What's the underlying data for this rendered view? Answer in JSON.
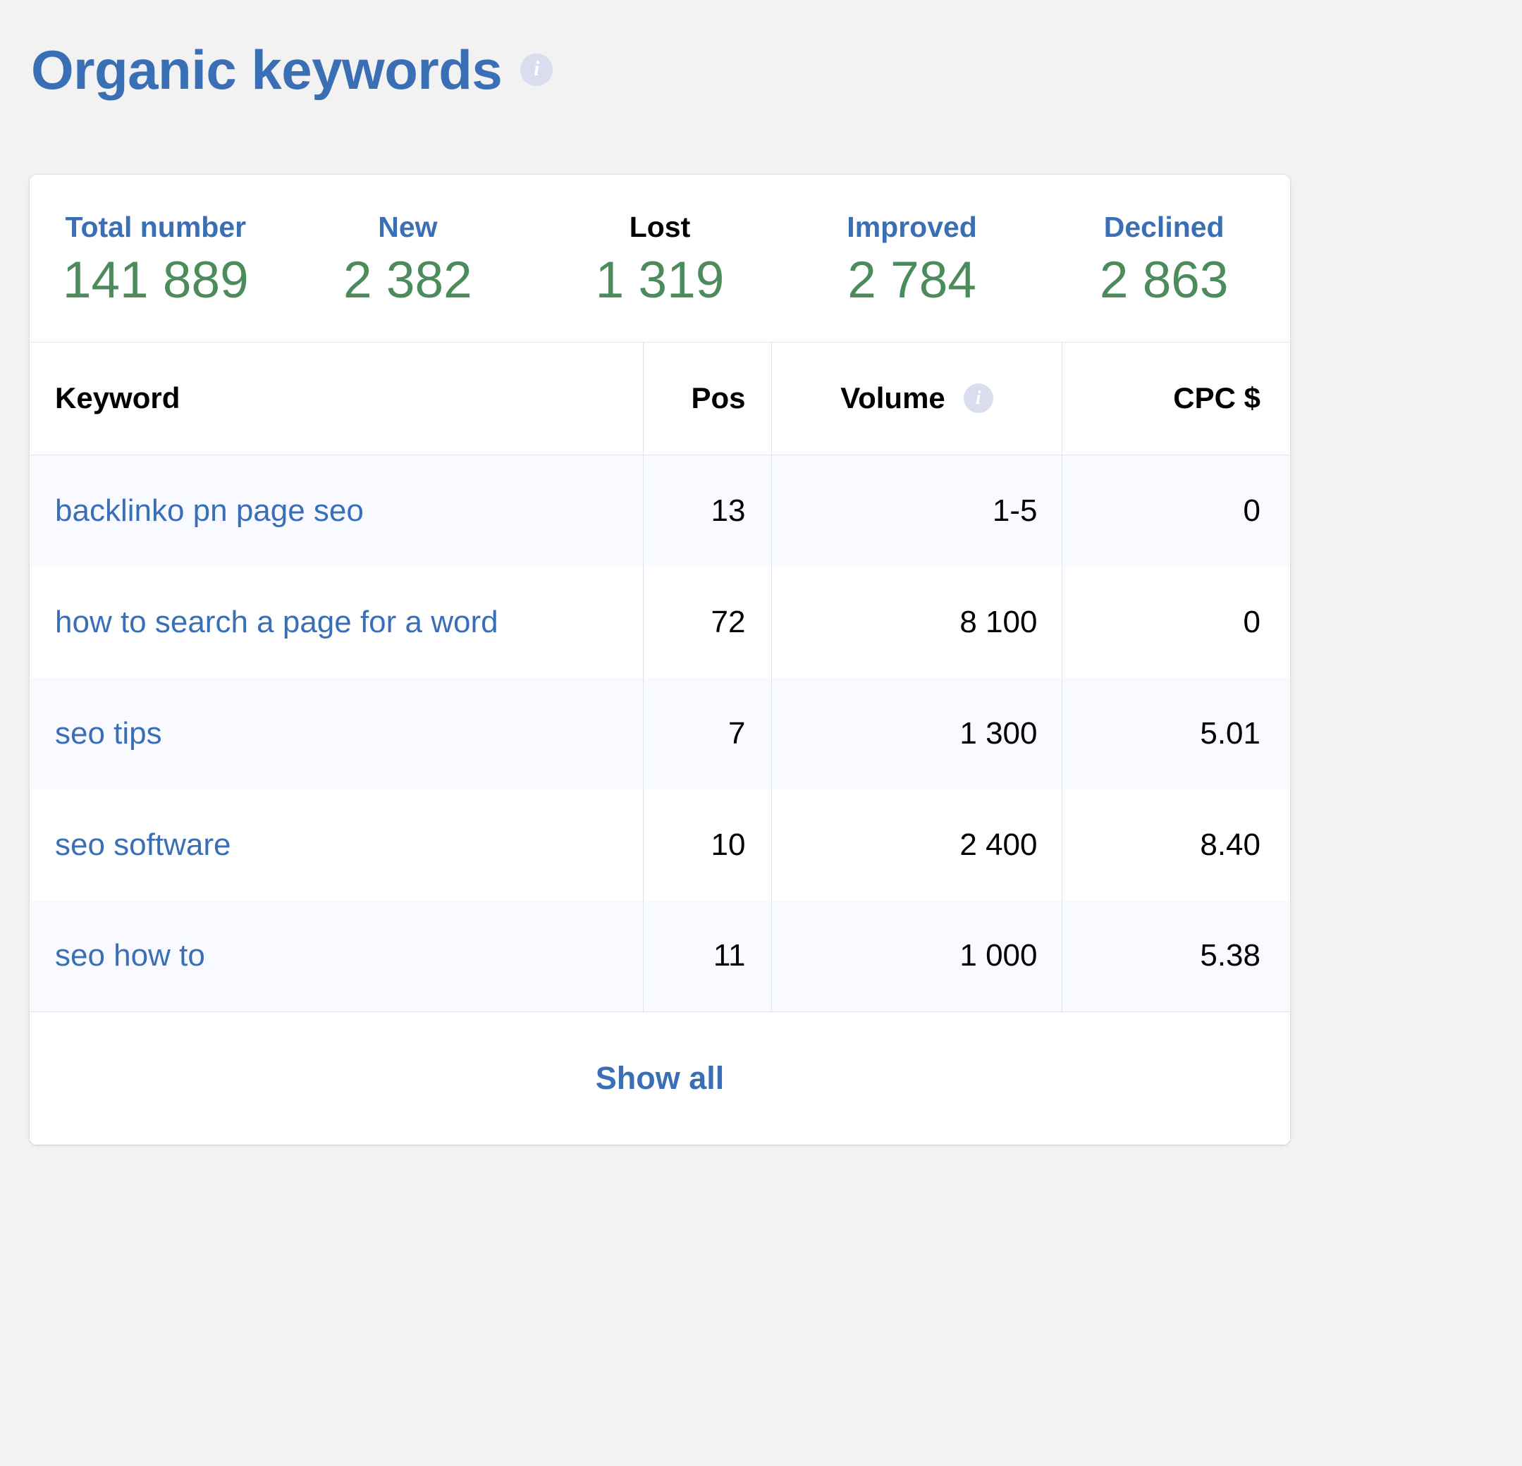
{
  "header": {
    "title": "Organic keywords",
    "info_icon": "info-icon"
  },
  "summary": {
    "items": [
      {
        "label": "Total number",
        "value": "141 889",
        "active": false
      },
      {
        "label": "New",
        "value": "2 382",
        "active": false
      },
      {
        "label": "Lost",
        "value": "1 319",
        "active": true
      },
      {
        "label": "Improved",
        "value": "2 784",
        "active": false
      },
      {
        "label": "Declined",
        "value": "2 863",
        "active": false
      }
    ],
    "label_color": "#3a6fb5",
    "active_label_color": "#000000",
    "value_color": "#4b8b5c"
  },
  "table": {
    "columns": [
      {
        "key": "keyword",
        "label": "Keyword",
        "align": "left"
      },
      {
        "key": "pos",
        "label": "Pos",
        "align": "right"
      },
      {
        "key": "volume",
        "label": "Volume",
        "align": "right",
        "info_icon": "info-icon"
      },
      {
        "key": "cpc",
        "label": "CPC $",
        "align": "right"
      }
    ],
    "rows": [
      {
        "keyword": "backlinko pn page seo",
        "pos": "13",
        "volume": "1-5",
        "cpc": "0"
      },
      {
        "keyword": "how to search a page for a word",
        "pos": "72",
        "volume": "8 100",
        "cpc": "0"
      },
      {
        "keyword": "seo tips",
        "pos": "7",
        "volume": "1 300",
        "cpc": "5.01"
      },
      {
        "keyword": "seo software",
        "pos": "10",
        "volume": "2 400",
        "cpc": "8.40"
      },
      {
        "keyword": "seo how to",
        "pos": "11",
        "volume": "1 000",
        "cpc": "5.38"
      }
    ],
    "link_color": "#3a6fb5"
  },
  "footer": {
    "show_all_label": "Show all"
  }
}
